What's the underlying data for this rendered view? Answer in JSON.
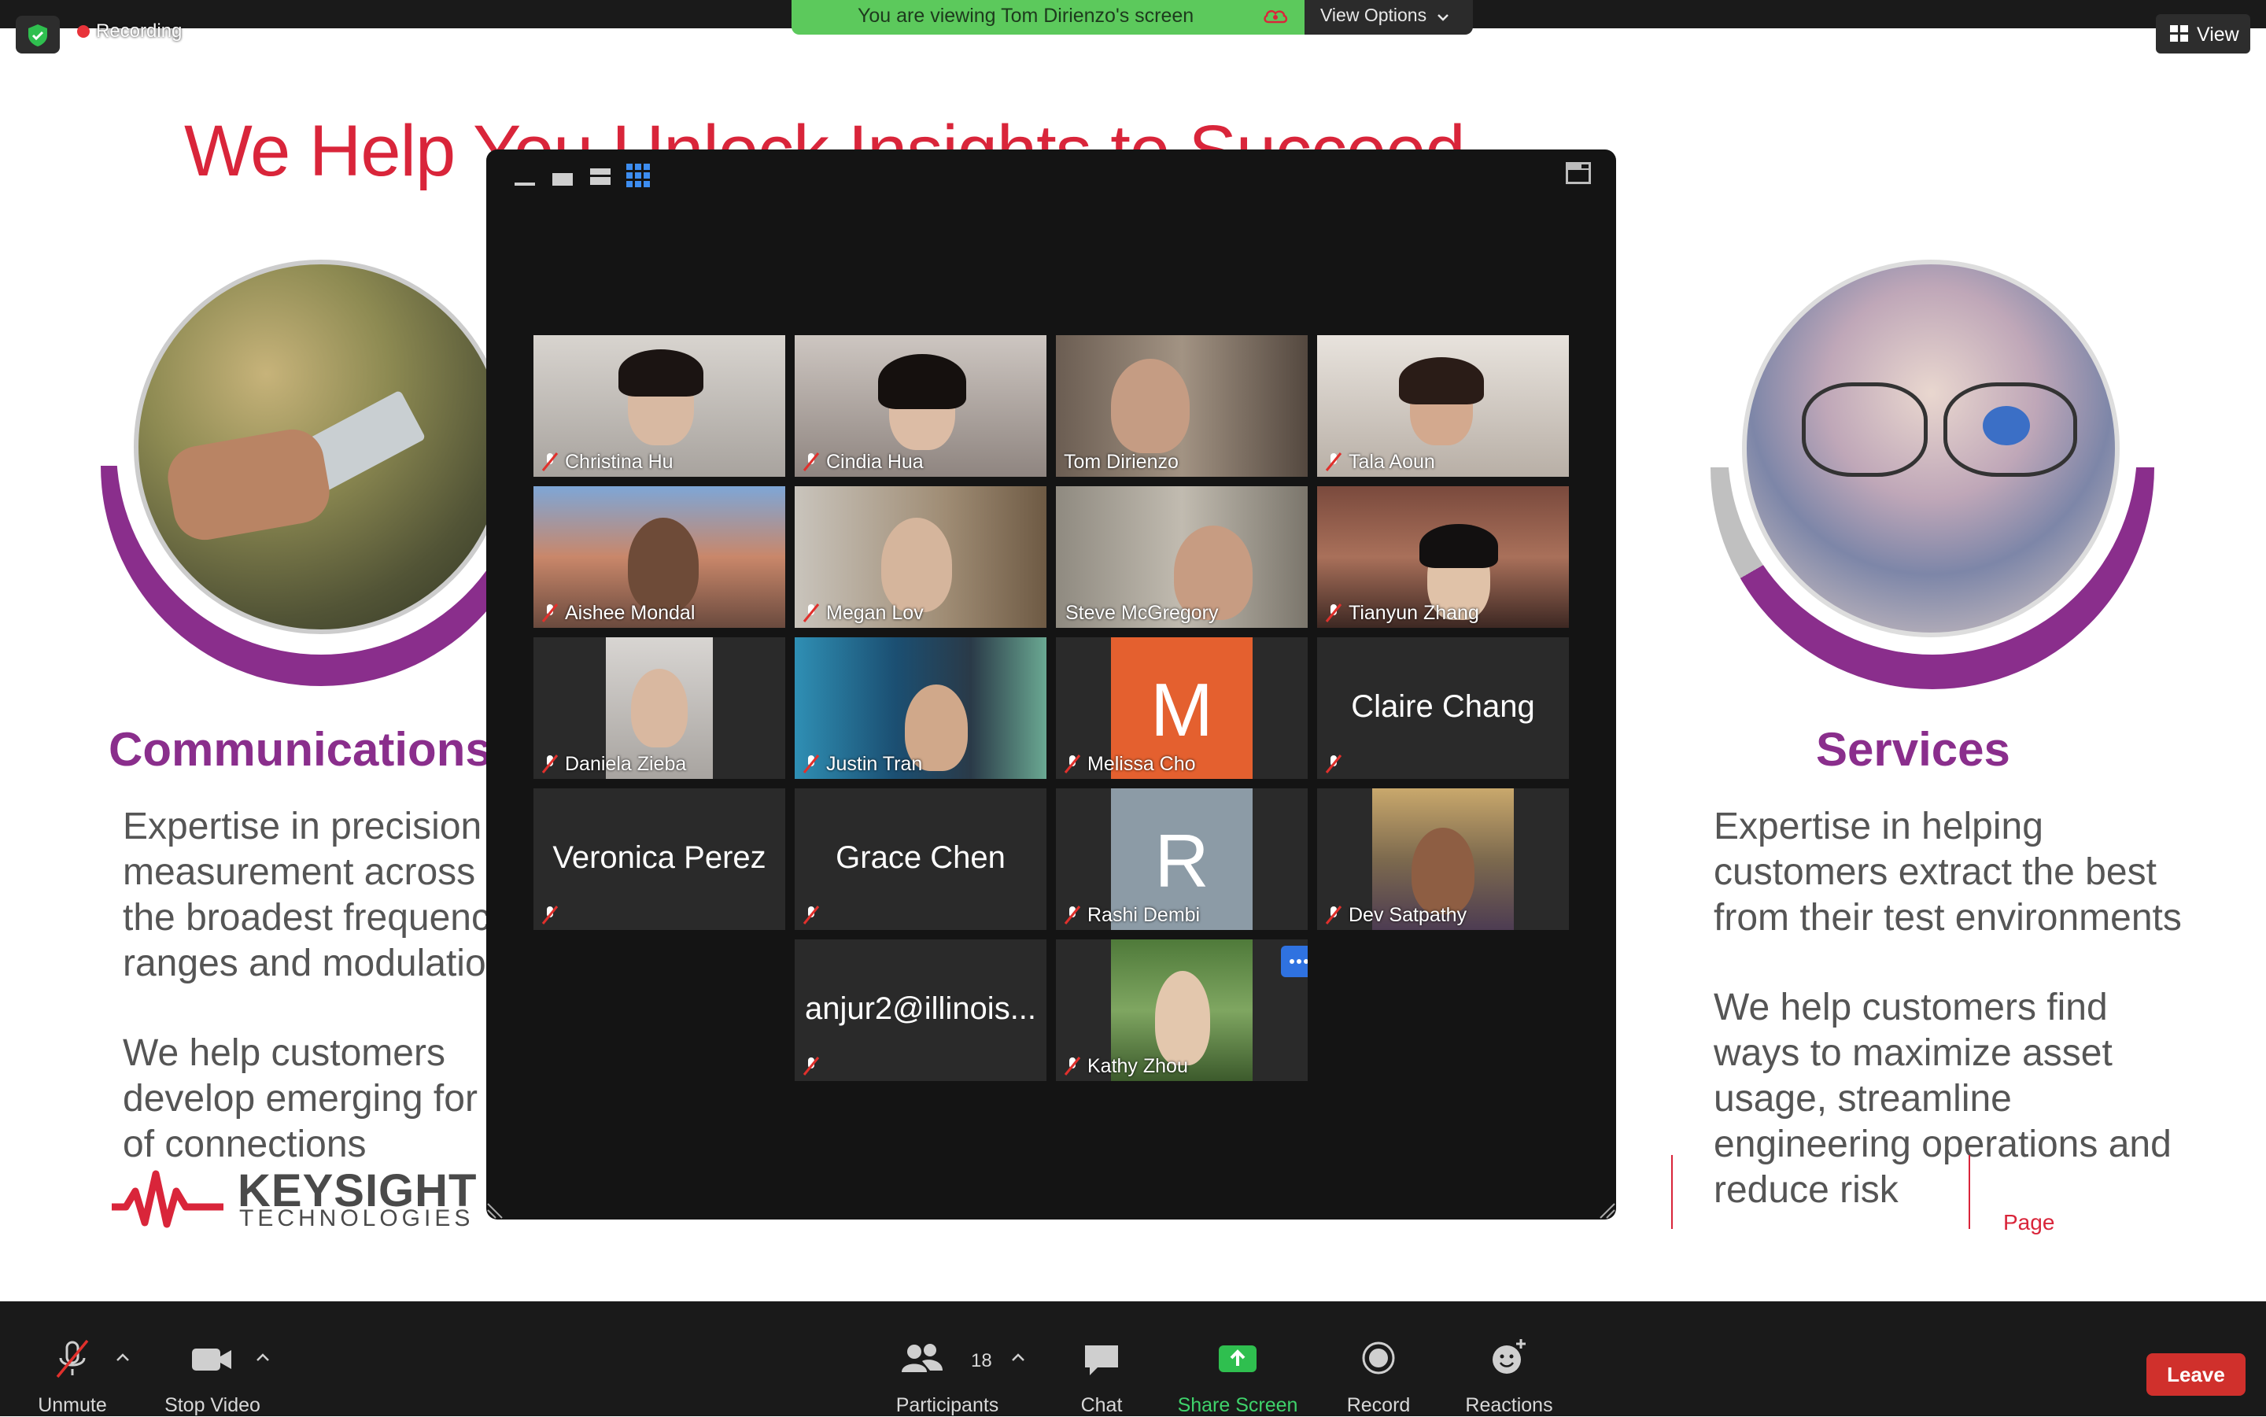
{
  "top": {
    "recording_label": "Recording",
    "viewing_text": "You are viewing Tom Dirienzo's screen",
    "view_options_label": "View Options",
    "view_button_label": "View"
  },
  "slide": {
    "title": "We Help You Unlock Insights to Succeed",
    "left_heading": "Communications",
    "left_p1": [
      "Expertise in precision",
      "measurement across",
      "the broadest frequenc",
      "ranges and modulatio"
    ],
    "left_p2": [
      "We help customers",
      "develop emerging for",
      "of connections"
    ],
    "right_heading": "Services",
    "right_p1": [
      "Expertise in helping",
      "customers extract the best",
      "from their test environments"
    ],
    "right_p2": [
      "We help customers find",
      "ways to maximize asset",
      "usage, streamline",
      "engineering operations and",
      "reduce risk"
    ],
    "logo_name": "KEYSIGHT",
    "logo_sub": "TECHNOLOGIES",
    "page_label": "Page",
    "colors": {
      "brand_red": "#d9253a",
      "purple": "#8a2e8c"
    }
  },
  "participants": [
    {
      "name": "Christina Hu",
      "muted": true,
      "video": true
    },
    {
      "name": "Cindia Hua",
      "muted": true,
      "video": true
    },
    {
      "name": "Tom Dirienzo",
      "muted": false,
      "video": true
    },
    {
      "name": "Tala Aoun",
      "muted": true,
      "video": true
    },
    {
      "name": "Aishee Mondal",
      "muted": true,
      "video": true
    },
    {
      "name": "Megan Lov",
      "muted": true,
      "video": true
    },
    {
      "name": "Steve McGregory",
      "muted": false,
      "video": true,
      "active_speaker": true
    },
    {
      "name": "Tianyun Zhang",
      "muted": true,
      "video": true
    },
    {
      "name": "Daniela Zieba",
      "muted": true,
      "video": true
    },
    {
      "name": "Justin Tran",
      "muted": true,
      "video": true
    },
    {
      "name": "Melissa Cho",
      "muted": true,
      "video": false,
      "avatar_letter": "M",
      "avatar_color": "#e4602f"
    },
    {
      "name": "Claire Chang",
      "muted": true,
      "video": false
    },
    {
      "name": "Veronica Perez",
      "muted": true,
      "video": false
    },
    {
      "name": "Grace Chen",
      "muted": true,
      "video": false
    },
    {
      "name": "Rashi Dembi",
      "muted": true,
      "video": false,
      "avatar_letter": "R",
      "avatar_color": "#8c9ba6"
    },
    {
      "name": "Dev Satpathy",
      "muted": true,
      "video": true
    },
    {
      "name": "anjur2@illinois...",
      "muted": true,
      "video": false
    },
    {
      "name": "Kathy Zhou",
      "muted": true,
      "video": true
    }
  ],
  "toolbar": {
    "unmute": "Unmute",
    "stop_video": "Stop Video",
    "participants": "Participants",
    "participant_count": "18",
    "chat": "Chat",
    "share_screen": "Share Screen",
    "record": "Record",
    "reactions": "Reactions",
    "leave": "Leave"
  }
}
